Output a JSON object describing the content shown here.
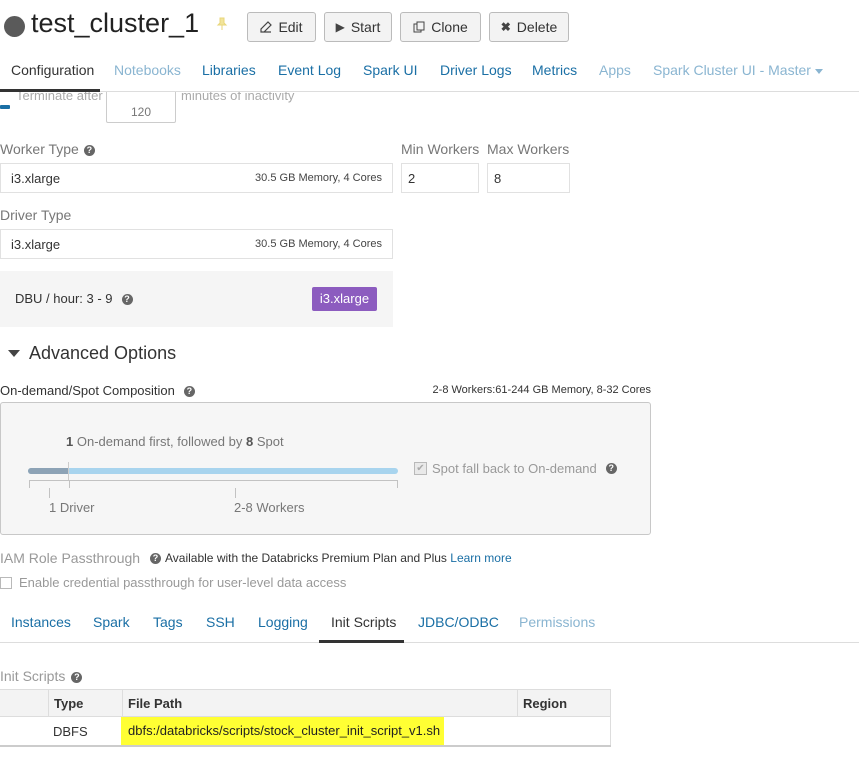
{
  "header": {
    "cluster_name": "test_cluster_1",
    "buttons": {
      "edit": "Edit",
      "start": "Start",
      "clone": "Clone",
      "delete": "Delete"
    }
  },
  "tabs": [
    {
      "label": "Configuration",
      "active": true
    },
    {
      "label": "Notebooks"
    },
    {
      "label": "Libraries"
    },
    {
      "label": "Event Log"
    },
    {
      "label": "Spark UI"
    },
    {
      "label": "Driver Logs"
    },
    {
      "label": "Metrics"
    },
    {
      "label": "Apps"
    },
    {
      "label": "Spark Cluster UI - Master"
    }
  ],
  "terminate": {
    "prefix": "Terminate after",
    "value": "120",
    "suffix": "minutes of inactivity"
  },
  "worker": {
    "label": "Worker Type",
    "type": "i3.xlarge",
    "spec": "30.5 GB Memory, 4 Cores",
    "min_label": "Min Workers",
    "min_value": "2",
    "max_label": "Max Workers",
    "max_value": "8"
  },
  "driver": {
    "label": "Driver Type",
    "type": "i3.xlarge",
    "spec": "30.5 GB Memory, 4 Cores"
  },
  "dbu": {
    "text": "DBU / hour: 3 - 9",
    "badge": "i3.xlarge",
    "badge_color": "#8c5cbf"
  },
  "advanced": {
    "label": "Advanced Options"
  },
  "composition": {
    "label": "On-demand/Spot Composition",
    "summary": "2-8 Workers:61-244 GB Memory, 8-32 Cores",
    "on_demand_count": "1",
    "title_mid": "On-demand first, followed by",
    "spot_count": "8",
    "title_end": "Spot",
    "driver_label": "1 Driver",
    "workers_label": "2-8 Workers",
    "spot_fallback": "Spot fall back to On-demand"
  },
  "iam": {
    "label": "IAM Role Passthrough",
    "note": "Available with the Databricks Premium Plan and Plus",
    "link": "Learn more",
    "credential": "Enable credential passthrough for user-level data access"
  },
  "subtabs": [
    {
      "label": "Instances"
    },
    {
      "label": "Spark"
    },
    {
      "label": "Tags"
    },
    {
      "label": "SSH"
    },
    {
      "label": "Logging"
    },
    {
      "label": "Init Scripts",
      "active": true
    },
    {
      "label": "JDBC/ODBC"
    },
    {
      "label": "Permissions"
    }
  ],
  "init_scripts": {
    "label": "Init Scripts",
    "columns": [
      "Type",
      "File Path",
      "Region"
    ],
    "rows": [
      {
        "type": "DBFS",
        "path": "dbfs:/databricks/scripts/stock_cluster_init_script_v1.sh",
        "region": ""
      }
    ]
  },
  "colors": {
    "link": "#1a6fa5",
    "highlight": "#ffff33"
  }
}
